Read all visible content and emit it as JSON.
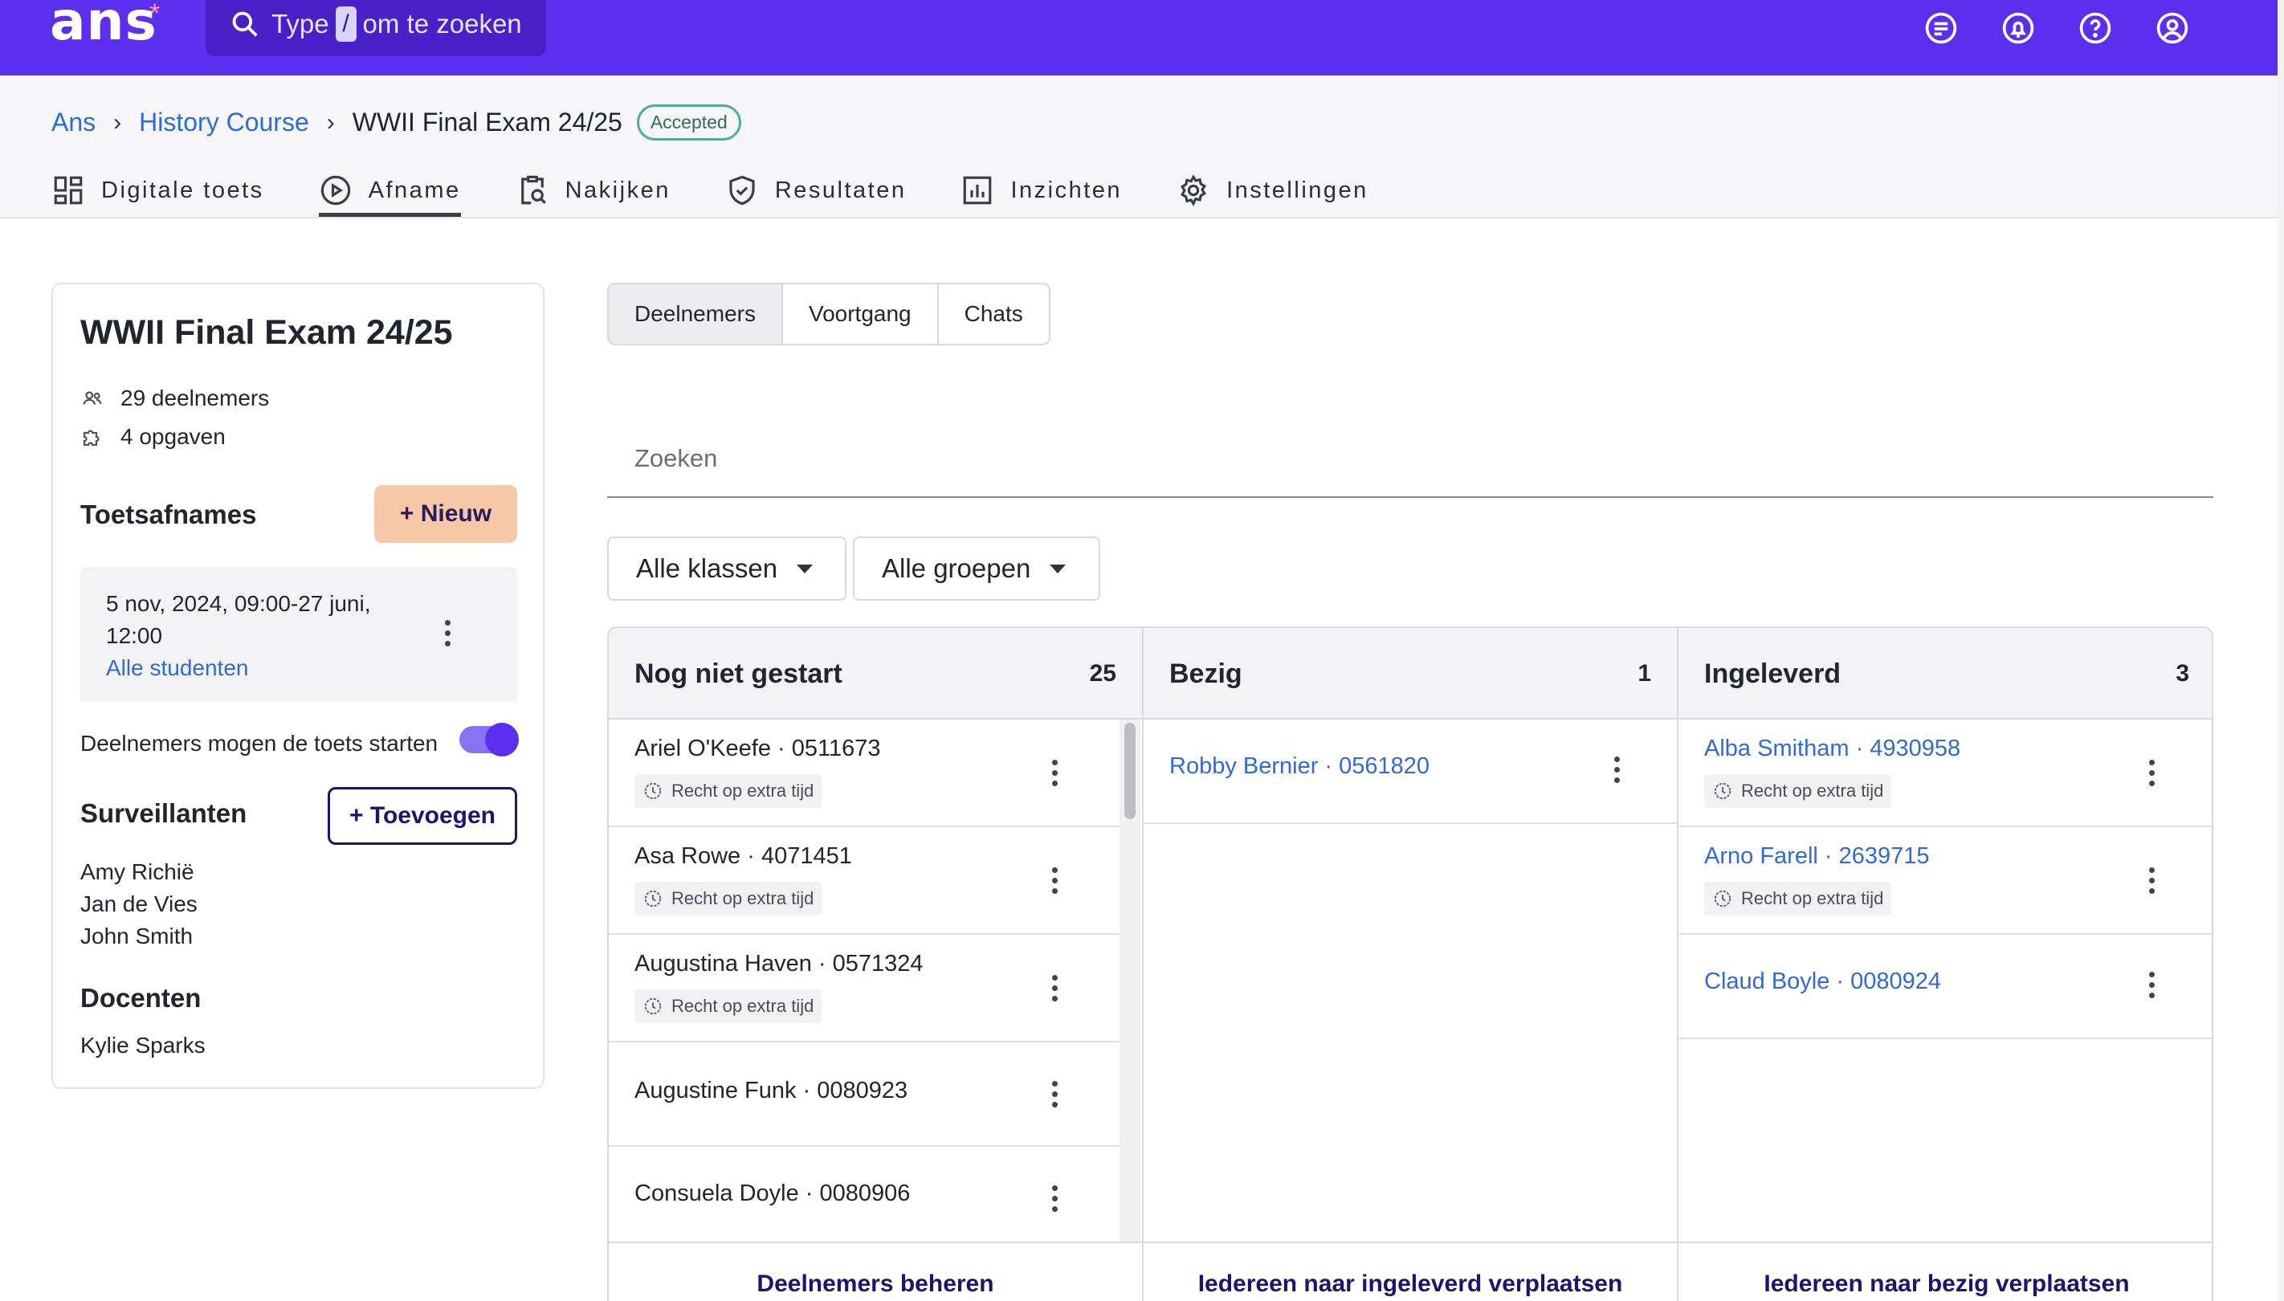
{
  "topbar": {
    "logo": "ans",
    "logo_star": "*",
    "search": {
      "prefix": "Type",
      "key": "/",
      "suffix": "om te zoeken"
    },
    "icons": [
      "chat-list-icon",
      "notification-bell-icon",
      "help-icon",
      "account-icon"
    ]
  },
  "breadcrumb": {
    "items": [
      "Ans",
      "History Course"
    ],
    "current": "WWII Final Exam 24/25",
    "status": "Accepted"
  },
  "tabs": [
    {
      "label": "Digitale toets",
      "icon": "grid-icon"
    },
    {
      "label": "Afname",
      "icon": "play-circle-icon",
      "active": true
    },
    {
      "label": "Nakijken",
      "icon": "clipboard-search-icon"
    },
    {
      "label": "Resultaten",
      "icon": "shield-check-icon"
    },
    {
      "label": "Inzichten",
      "icon": "bar-chart-icon"
    },
    {
      "label": "Instellingen",
      "icon": "gear-icon"
    }
  ],
  "card": {
    "title": "WWII Final Exam 24/25",
    "participants": "29 deelnemers",
    "questions": "4 opgaven",
    "sessions_title": "Toetsafnames",
    "new_button": "+ Nieuw",
    "session": {
      "date": "5 nov, 2024, 09:00-27 juni, 12:00",
      "audience": "Alle studenten"
    },
    "toggle_label": "Deelnemers mogen de toets starten",
    "toggle_on": true,
    "proctors_title": "Surveillanten",
    "add_button": "+ Toevoegen",
    "proctors": [
      "Amy Richië",
      "Jan de Vies",
      "John Smith"
    ],
    "teachers_title": "Docenten",
    "teachers": [
      "Kylie Sparks"
    ]
  },
  "segments": [
    "Deelnemers",
    "Voortgang",
    "Chats"
  ],
  "search_placeholder": "Zoeken",
  "filters": [
    "Alle klassen",
    "Alle groepen"
  ],
  "columns": [
    {
      "title": "Nog niet gestart",
      "count": "25",
      "items": [
        {
          "name": "Ariel O'Keefe · 0511673",
          "tag": "Recht op extra tijd"
        },
        {
          "name": "Asa Rowe · 4071451",
          "tag": "Recht op extra tijd"
        },
        {
          "name": "Augustina Haven · 0571324",
          "tag": "Recht op extra tijd"
        },
        {
          "name": "Augustine Funk · 0080923"
        },
        {
          "name": "Consuela Doyle · 0080906"
        }
      ],
      "footer": "Deelnemers beheren"
    },
    {
      "title": "Bezig",
      "count": "1",
      "items": [
        {
          "name": "Robby Bernier · 0561820"
        }
      ],
      "footer": "Iedereen naar ingeleverd verplaatsen"
    },
    {
      "title": "Ingeleverd",
      "count": "3",
      "items": [
        {
          "name": "Alba Smitham · 4930958",
          "tag": "Recht op extra tijd"
        },
        {
          "name": "Arno Farell · 2639715",
          "tag": "Recht op extra tijd"
        },
        {
          "name": "Claud Boyle · 0080924"
        }
      ],
      "footer": "Iedereen naar bezig verplaatsen"
    }
  ],
  "colors": {
    "brand": "#5b2ef0",
    "link": "#2e6bd6",
    "accent_button": "#f8c7a5",
    "badge_border": "#4fb09a"
  }
}
